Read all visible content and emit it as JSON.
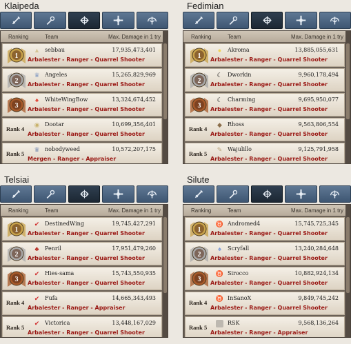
{
  "columns": {
    "ranking": "Ranking",
    "team": "Team",
    "damage": "Max. Damage in 1 try"
  },
  "panels": [
    {
      "server": "Klaipeda",
      "rows": [
        {
          "rank": "1",
          "name": "sebbau",
          "damage": "17,935,473,401",
          "cls": "Arbalester - Ranger - Quarrel Shooter",
          "avatar": "helmet-icon",
          "acolor": "#d6c596",
          "aglyph": "▲"
        },
        {
          "rank": "2",
          "name": "Angeles",
          "damage": "15,265,829,969",
          "cls": "Arbalester - Ranger - Quarrel Shooter",
          "avatar": "crest-icon",
          "acolor": "#8aa0c4",
          "aglyph": "♛"
        },
        {
          "rank": "3",
          "name": "WhiteWingBow",
          "damage": "13,324,674,452",
          "cls": "Arbalester - Ranger - Quarrel Shooter",
          "avatar": "bird-icon",
          "acolor": "#e23b2b",
          "aglyph": "♠"
        },
        {
          "rank": "Rank 4",
          "name": "Dootar",
          "damage": "10,699,356,401",
          "cls": "Arbalester - Ranger - Quarrel Shooter",
          "avatar": "emblem-icon",
          "acolor": "#c9b36e",
          "aglyph": "◉"
        },
        {
          "rank": "Rank 5",
          "name": "nobodyweed",
          "damage": "10,572,207,175",
          "cls": "Mergen - Ranger - Appraiser",
          "avatar": "crest-icon",
          "acolor": "#7c8fb2",
          "aglyph": "♛"
        }
      ]
    },
    {
      "server": "Fedimian",
      "rows": [
        {
          "rank": "1",
          "name": "Akroma",
          "damage": "13,885,055,631",
          "cls": "Arbalester - Ranger - Quarrel Shooter",
          "avatar": "chick-icon",
          "acolor": "#f0d35a",
          "aglyph": "●"
        },
        {
          "rank": "2",
          "name": "Dworkin",
          "damage": "9,960,178,494",
          "cls": "Arbalester - Ranger - Quarrel Shooter",
          "avatar": "moon-icon",
          "acolor": "#111111",
          "aglyph": "☾"
        },
        {
          "rank": "3",
          "name": "Charming",
          "damage": "9,695,950,077",
          "cls": "Arbalester - Ranger - Quarrel Shooter",
          "avatar": "moon-icon",
          "acolor": "#111111",
          "aglyph": "☾"
        },
        {
          "rank": "Rank 4",
          "name": "Rhoss",
          "damage": "9,563,806,554",
          "cls": "Arbalester - Ranger - Quarrel Shooter",
          "avatar": "shield-icon",
          "acolor": "#8a6d4a",
          "aglyph": "◆"
        },
        {
          "rank": "Rank 5",
          "name": "Wajulillo",
          "damage": "9,125,791,958",
          "cls": "Arbalester - Ranger - Quarrel Shooter",
          "avatar": "feather-icon",
          "acolor": "#b9a27a",
          "aglyph": "✎"
        }
      ]
    },
    {
      "server": "Telsiai",
      "rows": [
        {
          "rank": "1",
          "name": "DestinedWing",
          "damage": "19,745,427,291",
          "cls": "Arbalester - Ranger - Quarrel Shooter",
          "avatar": "wing-icon",
          "acolor": "#d02a2a",
          "aglyph": "✔"
        },
        {
          "rank": "2",
          "name": "Penril",
          "damage": "17,951,479,260",
          "cls": "Arbalester - Ranger - Quarrel Shooter",
          "avatar": "demon-icon",
          "acolor": "#b52218",
          "aglyph": "♣"
        },
        {
          "rank": "3",
          "name": "Hies-sama",
          "damage": "15,743,550,935",
          "cls": "Arbalester - Ranger - Quarrel Shooter",
          "avatar": "wing-icon",
          "acolor": "#d02a2a",
          "aglyph": "✔"
        },
        {
          "rank": "Rank 4",
          "name": "Fufa",
          "damage": "14,665,343,493",
          "cls": "Arbalester - Ranger - Appraiser",
          "avatar": "wing-icon",
          "acolor": "#d02a2a",
          "aglyph": "✔"
        },
        {
          "rank": "Rank 5",
          "name": "Victorica",
          "damage": "13,448,167,029",
          "cls": "Arbalester - Ranger - Quarrel Shooter",
          "avatar": "wing-icon",
          "acolor": "#d02a2a",
          "aglyph": "✔"
        }
      ]
    },
    {
      "server": "Silute",
      "rows": [
        {
          "rank": "1",
          "name": "Andromed4",
          "damage": "15,745,725,345",
          "cls": "Arbalester - Ranger - Quarrel Shooter",
          "avatar": "horns-icon",
          "acolor": "#333333",
          "aglyph": "♉"
        },
        {
          "rank": "2",
          "name": "Scryfall",
          "damage": "13,240,284,648",
          "cls": "Arbalester - Ranger - Quarrel Shooter",
          "avatar": "rabbit-icon",
          "acolor": "#7c9ad8",
          "aglyph": "♠"
        },
        {
          "rank": "3",
          "name": "Sirocco",
          "damage": "10,882,924,134",
          "cls": "Arbalester - Ranger - Quarrel Shooter",
          "avatar": "horns-icon",
          "acolor": "#333333",
          "aglyph": "♉"
        },
        {
          "rank": "Rank 4",
          "name": "InSanoX",
          "damage": "9,849,745,242",
          "cls": "Arbalester - Ranger - Quarrel Shooter",
          "avatar": "horns-icon",
          "acolor": "#333333",
          "aglyph": "♉"
        },
        {
          "rank": "Rank 5",
          "name": "RSK",
          "damage": "9,568,136,264",
          "cls": "Arbalester - Ranger - Appraiser",
          "avatar": "blank-icon",
          "acolor": "#bdb8b0",
          "aglyph": ""
        }
      ]
    }
  ],
  "tabs": [
    {
      "icon": "sword-icon"
    },
    {
      "icon": "staff-icon"
    },
    {
      "icon": "bow-icon",
      "active": true
    },
    {
      "icon": "cross-icon"
    },
    {
      "icon": "wings-icon"
    }
  ],
  "colors": {
    "gold": "#c9a34a",
    "silver": "#a9a9a9",
    "bronze": "#a85a2a",
    "classText": "#9a1814"
  }
}
